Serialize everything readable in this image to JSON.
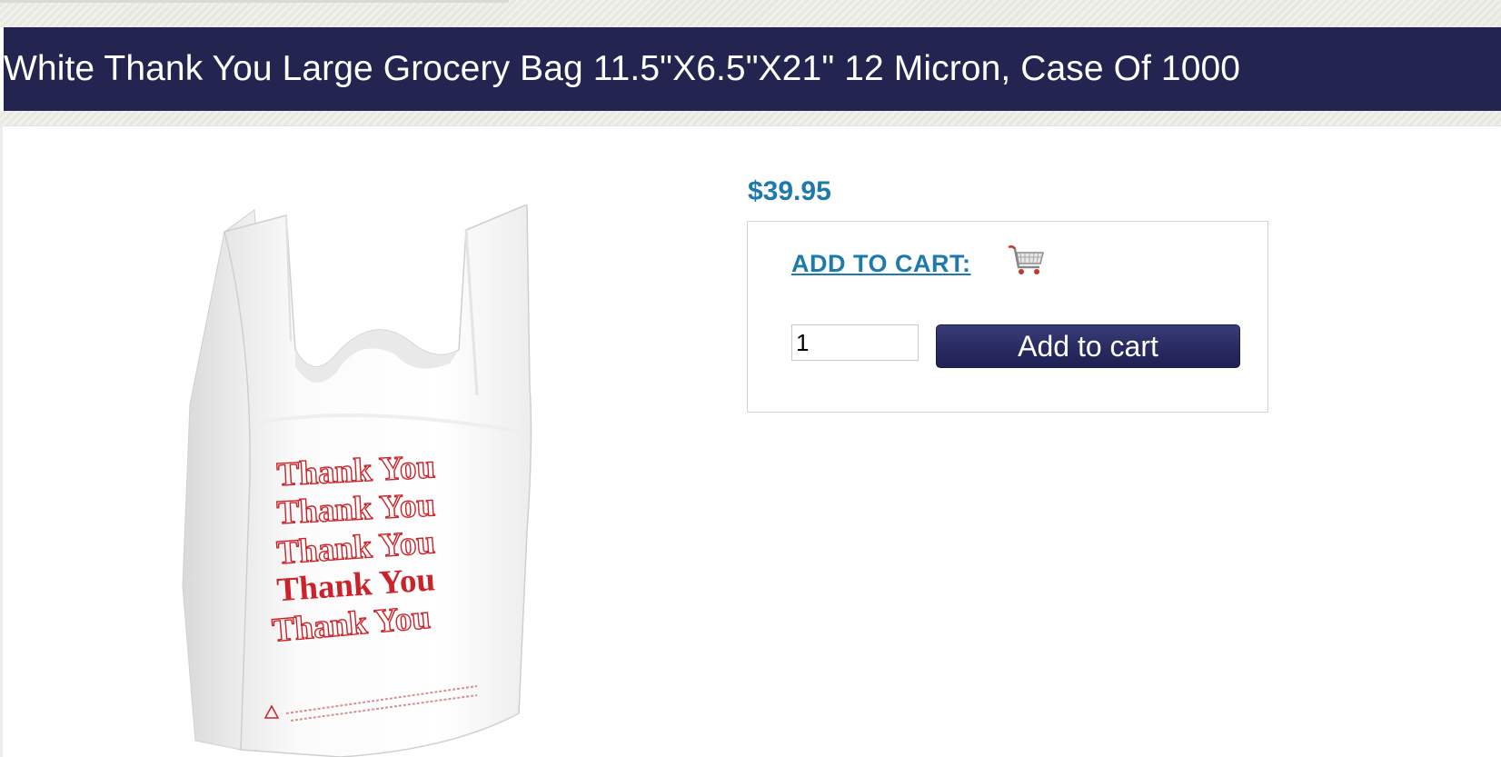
{
  "product": {
    "title": "White Thank You Large Grocery Bag 11.5\"X6.5\"X21\" 12 Micron, Case Of 1000",
    "price": "$39.95",
    "image_alt": "Thank You Grocery Bag",
    "bag_print": [
      "Thank You",
      "Thank You",
      "Thank You",
      "Thank You",
      "Thank You"
    ]
  },
  "cart": {
    "add_link_label": "ADD TO CART:",
    "quantity_value": "1",
    "button_label": "Add to cart"
  },
  "colors": {
    "title_bar": "#232550",
    "price_link": "#1c7aac",
    "bag_print_red": "#cc2229"
  },
  "icons": {
    "cart": "shopping-cart-icon"
  }
}
